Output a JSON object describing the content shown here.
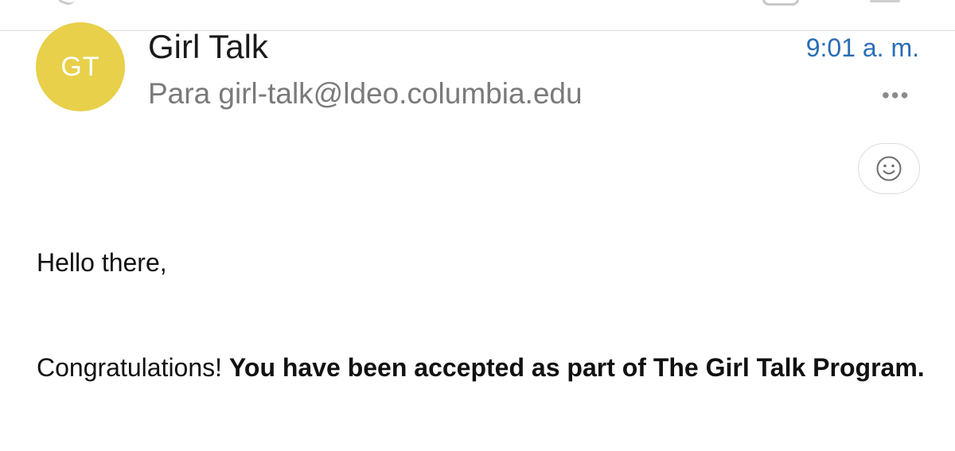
{
  "message": {
    "avatar_initials": "GT",
    "avatar_color": "#e8d04a",
    "sender_name": "Girl Talk",
    "recipient_line": "Para girl-talk@ldeo.columbia.edu",
    "time": "9:01 a. m.",
    "time_color": "#2a6db5",
    "more_label": "•••",
    "react_icon": "smiley-face-icon"
  },
  "body": {
    "greeting": "Hello there,",
    "congrats": "Congratulations! ",
    "accepted_bold": "You have been accepted as part of The Girl Talk Program."
  }
}
